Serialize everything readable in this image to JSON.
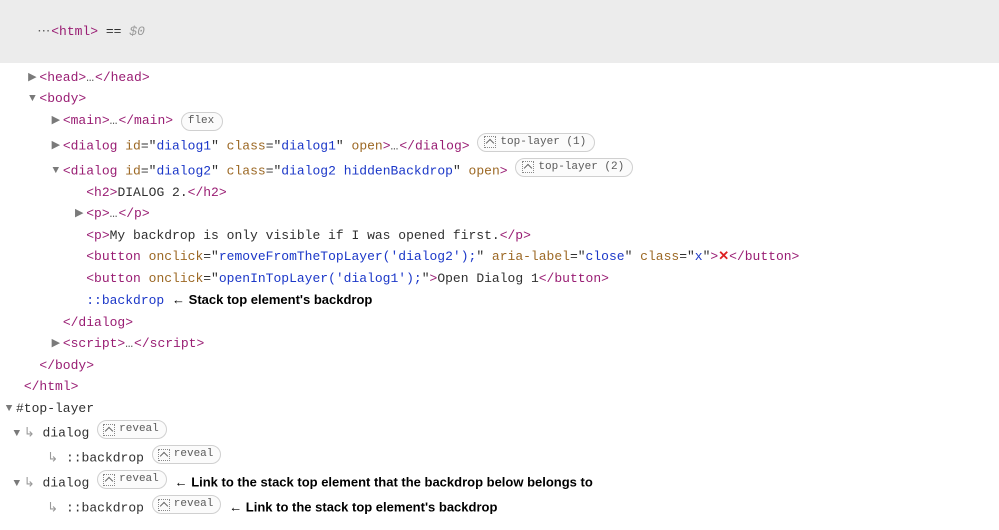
{
  "header": {
    "ellipsis": "⋯",
    "tag_open": "<html>",
    "equals": "==",
    "dollar": "$0"
  },
  "badges": {
    "flex": "flex",
    "top1": "top-layer (1)",
    "top2": "top-layer (2)",
    "reveal": "reveal"
  },
  "tags": {
    "head_open": "<head>",
    "head_close": "</head>",
    "body_open": "<body>",
    "body_close": "</body>",
    "html_close": "</html>",
    "main_open": "<main>",
    "main_close": "</main>",
    "dialog_open": "<dialog",
    "dialog_close": "</dialog>",
    "h2_open": "<h2>",
    "h2_close": "</h2>",
    "p_open": "<p>",
    "p_close": "</p>",
    "button_open": "<button",
    "button_close": "</button>",
    "script_open": "<script>",
    "script_close_tag": "</script>",
    "close_brkt": ">",
    "self_close": ">"
  },
  "attrs": {
    "id": "id",
    "class": "class",
    "open": "open",
    "onclick": "onclick",
    "aria_label": "aria-label"
  },
  "vals": {
    "dlg1_id": "dialog1",
    "dlg1_cls": "dialog1",
    "dlg2_id": "dialog2",
    "dlg2_cls": "dialog2 hiddenBackdrop",
    "onclick_remove": "removeFromTheTopLayer('dialog2');",
    "onclick_openD1": "openInTopLayer('dialog1');",
    "aria_close": "close",
    "btn_x_cls": "x"
  },
  "texts": {
    "dialog2_h2": "DIALOG 2.",
    "p_backdrop": "My backdrop is only visible if I was opened first.",
    "x_glyph": "✕",
    "open_d1_btn": "Open Dialog 1",
    "ellipsis": "…"
  },
  "pseudo": {
    "backdrop": "::backdrop"
  },
  "annot": {
    "stack_top_backdrop": "← Stack top element's backdrop",
    "link_stack_top_el": "← Link to the stack top element that the backdrop below belongs to",
    "link_stack_top_bd": "← Link to the stack top element's backdrop"
  },
  "toplayer": {
    "root": "#top-layer",
    "dialog": "dialog",
    "backdrop": "::backdrop",
    "indent_arrow": "↳"
  }
}
